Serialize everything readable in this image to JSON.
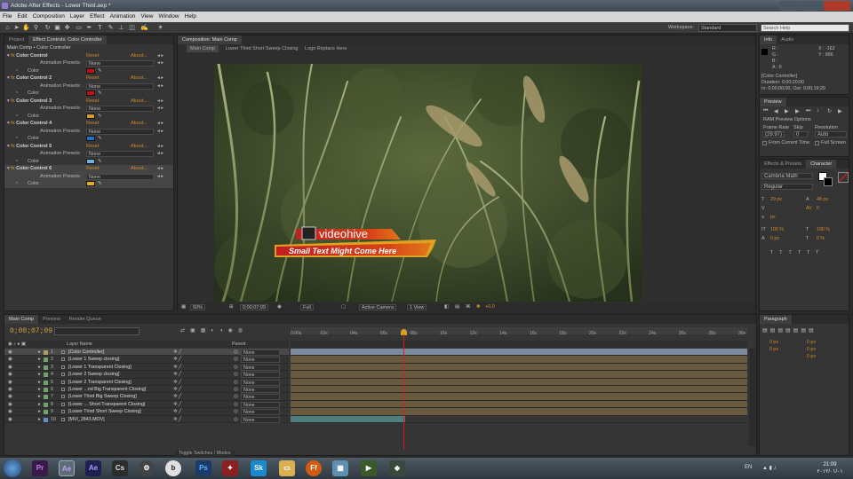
{
  "window": {
    "title": "Adobe After Effects - Lower Third.aep *"
  },
  "menu": [
    "File",
    "Edit",
    "Composition",
    "Layer",
    "Effect",
    "Animation",
    "View",
    "Window",
    "Help"
  ],
  "toolbar": {
    "workspace_label": "Workspace:",
    "workspace_value": "Standard",
    "search_placeholder": "Search Help"
  },
  "left_panel": {
    "tabs": [
      "Project",
      "Effect Controls: Color Controller"
    ],
    "breadcrumb": "Main Comp • Color Controller",
    "effects": [
      {
        "name": "Color Control",
        "reset": "Reset",
        "about": "About...",
        "presets_label": "Animation Presets:",
        "preset": "None",
        "color_label": "Color",
        "color": "#c01010"
      },
      {
        "name": "Color Control 2",
        "reset": "Reset",
        "about": "About...",
        "presets_label": "Animation Presets:",
        "preset": "None",
        "color_label": "Color",
        "color": "#c01010"
      },
      {
        "name": "Color Control 3",
        "reset": "Reset",
        "about": "About...",
        "presets_label": "Animation Presets:",
        "preset": "None",
        "color_label": "Color",
        "color": "#d8a020"
      },
      {
        "name": "Color Control 4",
        "reset": "Reset",
        "about": "About...",
        "presets_label": "Animation Presets:",
        "preset": "None",
        "color_label": "Color",
        "color": "#2070c8"
      },
      {
        "name": "Color Control 5",
        "reset": "Reset",
        "about": "About...",
        "presets_label": "Animation Presets:",
        "preset": "None",
        "color_label": "Color",
        "color": "#70b0e0"
      },
      {
        "name": "Color Control 6",
        "reset": "Reset",
        "about": "About...",
        "presets_label": "Animation Presets:",
        "preset": "None",
        "color_label": "Color",
        "color": "#e0b020"
      }
    ]
  },
  "comp": {
    "tab": "Composition: Main Comp",
    "breadcrumbs": [
      "Main Comp",
      "Lower Third Short Sweep Closing",
      "Logo Replace Here"
    ],
    "overlay": {
      "brand": "videohive",
      "subtitle": "Small Text Might Come Here"
    },
    "footer": {
      "zoom": "50%",
      "timecode": "0;00;07;09",
      "resolution": "Full",
      "camera": "Active Camera",
      "views": "1 View",
      "exposure": "+0.0"
    }
  },
  "info": {
    "tabs": [
      "Info",
      "Audio"
    ],
    "r": "R :",
    "g": "G :",
    "b": "B :",
    "a": "A : 0",
    "x": "X : -162",
    "y": "Y : 896",
    "layer": "[Color Controller]",
    "duration": "Duration: 0;00;20;00",
    "inout": "In: 0;00;00;00, Out: 0;00;19;29"
  },
  "preview": {
    "title": "Preview",
    "ram": "RAM Preview Options",
    "frame_rate_label": "Frame Rate",
    "skip_label": "Skip",
    "resolution_label": "Resolution",
    "frame_rate": "(29.97)",
    "skip": "0",
    "resolution": "Auto",
    "from_current": "From Current Time",
    "full_screen": "Full Screen"
  },
  "character": {
    "tabs": [
      "Effects & Presets",
      "Character"
    ],
    "font": "Cambria Math",
    "style": "Regular",
    "size": "29 px",
    "leading": "48 px",
    "tracking": "0",
    "scale_v": "100 %",
    "scale_h": "100 %",
    "baseline": "0 px",
    "tsume": "0 %",
    "unit": "px"
  },
  "paragraph": {
    "title": "Paragraph",
    "v1": "0 px",
    "v2": "0 px",
    "v3": "0 px",
    "v4": "0 px",
    "v5": "0 px"
  },
  "timeline": {
    "tabs": [
      "Main Comp",
      "Preview",
      "Render Queue"
    ],
    "timecode": "0;00;07;09",
    "col_layer": "Layer Name",
    "col_parent": "Parent",
    "ticks": [
      "0:00s",
      "02s",
      "04s",
      "06s",
      "08s",
      "10s",
      "12s",
      "14s",
      "16s",
      "18s",
      "20s",
      "22s",
      "24s",
      "26s",
      "28s",
      "30s"
    ],
    "layers": [
      {
        "num": "1",
        "name": "[Color Controller]",
        "parent": "None",
        "color": "#b0a060"
      },
      {
        "num": "2",
        "name": "[Lower 1 Sweep closing]",
        "parent": "None",
        "color": "#70a070"
      },
      {
        "num": "3",
        "name": "[Lower 1 Transparent Closing]",
        "parent": "None",
        "color": "#70a070"
      },
      {
        "num": "4",
        "name": "[Lower 2 Sweep closing]",
        "parent": "None",
        "color": "#70a070"
      },
      {
        "num": "5",
        "name": "[Lower 2 Transparent Closing]",
        "parent": "None",
        "color": "#70a070"
      },
      {
        "num": "6",
        "name": "[Lower ...nd Big Transparent Closing]",
        "parent": "None",
        "color": "#70a070"
      },
      {
        "num": "7",
        "name": "[Lower Third Big Sweep Closing]",
        "parent": "None",
        "color": "#70a070"
      },
      {
        "num": "8",
        "name": "[Lower ... Short Transparent Closing]",
        "parent": "None",
        "color": "#70a070"
      },
      {
        "num": "9",
        "name": "[Lower Third Short Sweep Closing]",
        "parent": "None",
        "color": "#70a070"
      },
      {
        "num": "10",
        "name": "[MVI_2843.MOV]",
        "parent": "None",
        "color": "#6090c0"
      }
    ],
    "toggle": "Toggle Switches / Modes"
  },
  "taskbar": {
    "lang": "EN",
    "time": "21:09",
    "date": "۲۰۱۲/۰۱/۰۱",
    "icons": [
      "Pr",
      "Ae",
      "Ae",
      "Cs",
      "Ps",
      "Sk",
      "Ff"
    ]
  }
}
